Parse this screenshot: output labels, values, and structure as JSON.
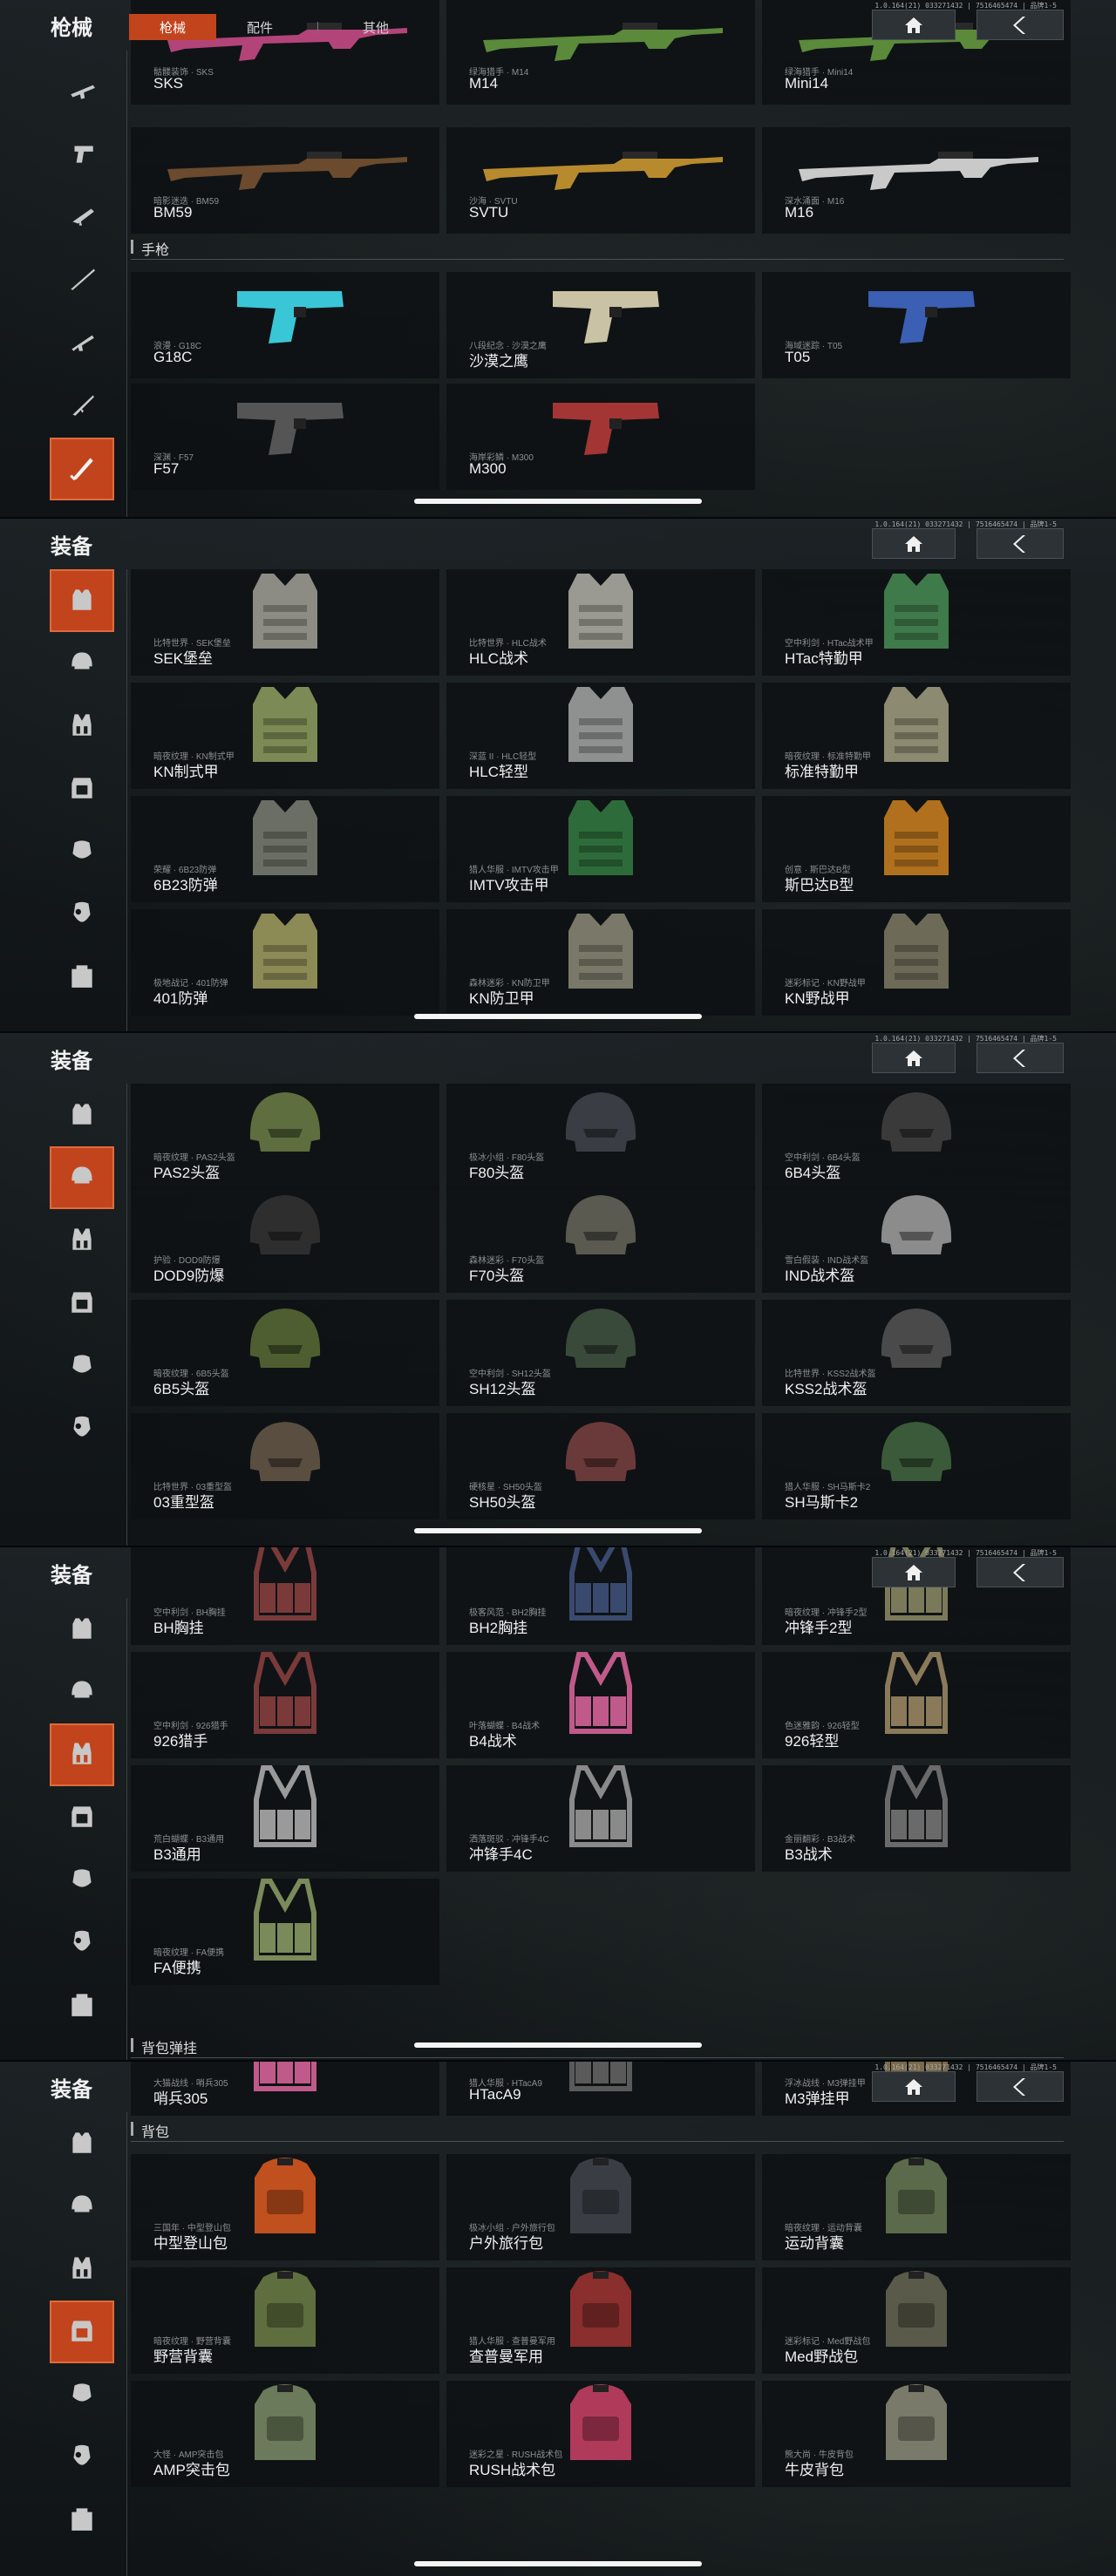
{
  "ui": {
    "version": "1.0.164(21) 033271432 | 7516465474 | 品牌1-5",
    "home_label": "home",
    "back_label": "back"
  },
  "panels": [
    {
      "title": "枪械",
      "tabs": [
        {
          "label": "枪械",
          "active": true
        },
        {
          "label": "配件"
        },
        {
          "label": "其他"
        }
      ],
      "sidebar": [
        {
          "icon": "rifle-icon"
        },
        {
          "icon": "pistol-icon"
        },
        {
          "icon": "smg-icon"
        },
        {
          "icon": "sniper-icon"
        },
        {
          "icon": "shotgun-icon"
        },
        {
          "icon": "marksman-icon"
        },
        {
          "icon": "melee-icon",
          "active": true
        }
      ],
      "sections": [
        {
          "label": "手枪"
        }
      ],
      "items": [
        {
          "sub": "骷髅装饰 · SKS",
          "name": "SKS",
          "kind": "gun",
          "color": "#b3447a"
        },
        {
          "sub": "绿海猎手 · M14",
          "name": "M14",
          "kind": "gun",
          "color": "#5a8a3a"
        },
        {
          "sub": "绿海猎手 · Mini14",
          "name": "Mini14",
          "kind": "gun",
          "color": "#5a8a3a"
        },
        {
          "sub": "暗影迷迭 · BM59",
          "name": "BM59",
          "kind": "gun",
          "color": "#6b4a2e"
        },
        {
          "sub": "沙海 · SVTU",
          "name": "SVTU",
          "kind": "gun",
          "color": "#b88a2e"
        },
        {
          "sub": "深水涌面 · M16",
          "name": "M16",
          "kind": "gun",
          "color": "#c9c9c9"
        },
        {
          "sub": "浪漫 · G18C",
          "name": "G18C",
          "kind": "pistol",
          "color": "#39c7d8"
        },
        {
          "sub": "八段纪念 · 沙漠之鹰",
          "name": "沙漠之鹰",
          "kind": "pistol",
          "color": "#c9c2a4"
        },
        {
          "sub": "海域迷踪 · T05",
          "name": "T05",
          "kind": "pistol",
          "color": "#3a5fb3"
        },
        {
          "sub": "深渊 · F57",
          "name": "F57",
          "kind": "pistol",
          "color": "#555555"
        },
        {
          "sub": "海岸彩鳞 · M300",
          "name": "M300",
          "kind": "pistol",
          "color": "#a33535"
        }
      ]
    },
    {
      "title": "装备",
      "sidebar": [
        {
          "icon": "vest-icon",
          "active": true
        },
        {
          "icon": "helmet-icon"
        },
        {
          "icon": "chest-rig-icon"
        },
        {
          "icon": "armor-plate-icon"
        },
        {
          "icon": "mask-icon"
        },
        {
          "icon": "gas-mask-icon"
        },
        {
          "icon": "bag-icon"
        }
      ],
      "items": [
        {
          "sub": "比特世界 · SEK堡垒",
          "name": "SEK堡垒",
          "kind": "vest",
          "color": "#8c8c84"
        },
        {
          "sub": "比特世界 · HLC战术",
          "name": "HLC战术",
          "kind": "vest",
          "color": "#9a9a92"
        },
        {
          "sub": "空中利剑 · HTac战术甲",
          "name": "HTac特勤甲",
          "kind": "vest",
          "color": "#3f7a4a"
        },
        {
          "sub": "暗夜纹理 · KN制式甲",
          "name": "KN制式甲",
          "kind": "vest",
          "color": "#7c8a55"
        },
        {
          "sub": "深蓝 II · HLC轻型",
          "name": "HLC轻型",
          "kind": "vest",
          "color": "#8f9090"
        },
        {
          "sub": "暗夜纹理 · 标准特勤甲",
          "name": "标准特勤甲",
          "kind": "vest",
          "color": "#8c8a70"
        },
        {
          "sub": "荣耀 · 6B23防弹",
          "name": "6B23防弹",
          "kind": "vest",
          "color": "#6b6e64"
        },
        {
          "sub": "猎人华服 · IMTV攻击甲",
          "name": "IMTV攻击甲",
          "kind": "vest",
          "color": "#2e6b3a"
        },
        {
          "sub": "创意 · 斯巴达B型",
          "name": "斯巴达B型",
          "kind": "vest",
          "color": "#b0701e"
        },
        {
          "sub": "极地战记 · 401防弹",
          "name": "401防弹",
          "kind": "vest",
          "color": "#8c8a55"
        },
        {
          "sub": "森林迷彩 · KN防卫甲",
          "name": "KN防卫甲",
          "kind": "vest",
          "color": "#7a7868"
        },
        {
          "sub": "迷彩标记 · KN野战甲",
          "name": "KN野战甲",
          "kind": "vest",
          "color": "#6e6a58"
        }
      ]
    },
    {
      "title": "装备",
      "sidebar": [
        {
          "icon": "vest-icon"
        },
        {
          "icon": "helmet-icon",
          "active": true
        },
        {
          "icon": "chest-rig-icon"
        },
        {
          "icon": "armor-plate-icon"
        },
        {
          "icon": "mask-icon"
        },
        {
          "icon": "gas-mask-icon"
        }
      ],
      "items": [
        {
          "sub": "暗夜纹理 · PAS2头盔",
          "name": "PAS2头盔",
          "kind": "helmet",
          "color": "#5e6e3e"
        },
        {
          "sub": "极冰小组 · F80头盔",
          "name": "F80头盔",
          "kind": "helmet",
          "color": "#3a3e44"
        },
        {
          "sub": "空中利剑 · 6B4头盔",
          "name": "6B4头盔",
          "kind": "helmet",
          "color": "#3a3a3a"
        },
        {
          "sub": "护验 · DOD9防爆",
          "name": "DOD9防爆",
          "kind": "helmet",
          "color": "#2e2e2e"
        },
        {
          "sub": "森林迷彩 · F70头盔",
          "name": "F70头盔",
          "kind": "helmet",
          "color": "#5a5a50"
        },
        {
          "sub": "雪白假装 · IND战术盔",
          "name": "IND战术盔",
          "kind": "helmet",
          "color": "#8c8c8c"
        },
        {
          "sub": "暗夜纹理 · 6B5头盔",
          "name": "6B5头盔",
          "kind": "helmet",
          "color": "#4e5e30"
        },
        {
          "sub": "空中利剑 · SH12头盔",
          "name": "SH12头盔",
          "kind": "helmet",
          "color": "#3a4a3a"
        },
        {
          "sub": "比特世界 · KSS2战术盔",
          "name": "KSS2战术盔",
          "kind": "helmet",
          "color": "#4a4a4a"
        },
        {
          "sub": "比特世界 · 03重型盔",
          "name": "03重型盔",
          "kind": "helmet",
          "color": "#5a4e40"
        },
        {
          "sub": "硬核星 · SH50头盔",
          "name": "SH50头盔",
          "kind": "helmet",
          "color": "#6a3a3a"
        },
        {
          "sub": "猎人华服 · SH马斯卡2",
          "name": "SH马斯卡2",
          "kind": "helmet",
          "color": "#3a5a3a"
        }
      ]
    },
    {
      "title": "装备",
      "sidebar": [
        {
          "icon": "vest-icon"
        },
        {
          "icon": "helmet-icon"
        },
        {
          "icon": "chest-rig-icon",
          "active": true
        },
        {
          "icon": "armor-plate-icon"
        },
        {
          "icon": "mask-icon"
        },
        {
          "icon": "gas-mask-icon"
        },
        {
          "icon": "bag-icon"
        }
      ],
      "sections": [
        {
          "label": "背包弹挂"
        }
      ],
      "items": [
        {
          "sub": "空中利剑 · BH胸挂",
          "name": "BH胸挂",
          "kind": "rig",
          "color": "#7a3a3a"
        },
        {
          "sub": "极客风范 · BH2胸挂",
          "name": "BH2胸挂",
          "kind": "rig",
          "color": "#3a4a6e"
        },
        {
          "sub": "暗夜纹理 · 冲锋手2型",
          "name": "冲锋手2型",
          "kind": "rig",
          "color": "#7a7a5a"
        },
        {
          "sub": "空中利剑 · 926猎手",
          "name": "926猎手",
          "kind": "rig",
          "color": "#7a3a3a"
        },
        {
          "sub": "叶落蝴蝶 · B4战术",
          "name": "B4战术",
          "kind": "rig",
          "color": "#c05a8a"
        },
        {
          "sub": "色迷雅韵 · 926轻型",
          "name": "926轻型",
          "kind": "rig",
          "color": "#8a7a5a"
        },
        {
          "sub": "荒白蝴蝶 · B3通用",
          "name": "B3通用",
          "kind": "rig",
          "color": "#9a9a9a"
        },
        {
          "sub": "洒落斑驳 · 冲锋手4C",
          "name": "冲锋手4C",
          "kind": "rig",
          "color": "#8a8a8a"
        },
        {
          "sub": "金丽翻彩 · B3战术",
          "name": "B3战术",
          "kind": "rig",
          "color": "#6a6a6a"
        },
        {
          "sub": "暗夜纹理 · FA便携",
          "name": "FA便携",
          "kind": "rig",
          "color": "#7a8a5a"
        }
      ]
    },
    {
      "title": "装备",
      "sidebar": [
        {
          "icon": "vest-icon"
        },
        {
          "icon": "helmet-icon"
        },
        {
          "icon": "chest-rig-icon"
        },
        {
          "icon": "armor-plate-icon",
          "active": true
        },
        {
          "icon": "mask-icon"
        },
        {
          "icon": "gas-mask-icon"
        },
        {
          "icon": "bag-icon"
        }
      ],
      "sections": [
        {
          "label": "背包"
        }
      ],
      "items": [
        {
          "sub": "大猫战线 · 哨兵305",
          "name": "哨兵305",
          "kind": "rig",
          "color": "#c05a8a"
        },
        {
          "sub": "猎人华服 · HTacA9",
          "name": "HTacA9",
          "kind": "rig",
          "color": "#5a5a5a"
        },
        {
          "sub": "浮冰战线 · M3弹挂甲",
          "name": "M3弹挂甲",
          "kind": "rig",
          "color": "#7a6a4a"
        },
        {
          "sub": "三国年 · 中型登山包",
          "name": "中型登山包",
          "kind": "bag",
          "color": "#c0501e"
        },
        {
          "sub": "极冰小组 · 户外旅行包",
          "name": "户外旅行包",
          "kind": "bag",
          "color": "#3a3e44"
        },
        {
          "sub": "暗夜纹理 · 运动背囊",
          "name": "运动背囊",
          "kind": "bag",
          "color": "#5a6a4a"
        },
        {
          "sub": "暗夜纹理 · 野营背囊",
          "name": "野营背囊",
          "kind": "bag",
          "color": "#5e6e3e"
        },
        {
          "sub": "猎人华服 · 查普曼军用",
          "name": "查普曼军用",
          "kind": "bag",
          "color": "#8a2e2e"
        },
        {
          "sub": "迷彩标记 · Med野战包",
          "name": "Med野战包",
          "kind": "bag",
          "color": "#5a5a4a"
        },
        {
          "sub": "大怪 · AMP突击包",
          "name": "AMP突击包",
          "kind": "bag",
          "color": "#6a7a5a"
        },
        {
          "sub": "迷彩之星 · RUSH战术包",
          "name": "RUSH战术包",
          "kind": "bag",
          "color": "#b03a5a"
        },
        {
          "sub": "熊大尚 · 牛皮背包",
          "name": "牛皮背包",
          "kind": "bag",
          "color": "#7a7a6a"
        }
      ]
    }
  ]
}
